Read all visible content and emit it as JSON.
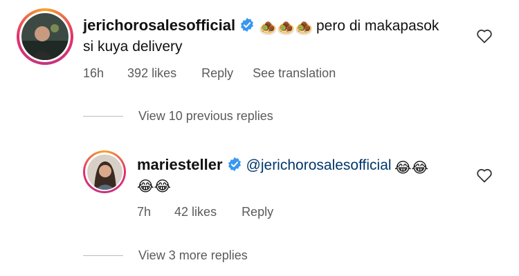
{
  "comment1": {
    "username": "jerichorosalesofficial",
    "emoji_text": "🧆🧆🧆",
    "text_line1": "pero di makapasok",
    "text_line2": "si kuya delivery",
    "time": "16h",
    "likes": "392 likes",
    "reply": "Reply",
    "translation": "See translation"
  },
  "view_previous": "View 10 previous replies",
  "comment2": {
    "username": "mariesteller",
    "mention": "@jerichorosalesofficial",
    "emoji_line1": "😂😂",
    "emoji_line2": "😂😂",
    "time": "7h",
    "likes": "42 likes",
    "reply": "Reply"
  },
  "view_more": "View 3 more replies",
  "colors": {
    "verified": "#3897f0",
    "meta_text": "#5a5a5a",
    "ring_start": "#f7a32b",
    "ring_end": "#c13584"
  }
}
